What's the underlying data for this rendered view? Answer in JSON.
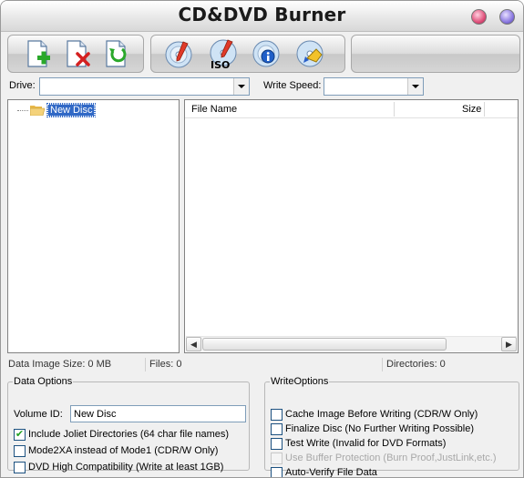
{
  "window": {
    "title": "CD&DVD Burner"
  },
  "toolbar": {
    "file_buttons": [
      {
        "icon": "add-file-icon"
      },
      {
        "icon": "remove-file-icon"
      },
      {
        "icon": "refresh-file-icon"
      }
    ],
    "disc_buttons": [
      {
        "icon": "burn-disc-icon"
      },
      {
        "icon": "burn-iso-icon",
        "label": "ISO"
      },
      {
        "icon": "disc-info-icon"
      },
      {
        "icon": "erase-disc-icon"
      }
    ]
  },
  "drive": {
    "label": "Drive:",
    "value": ""
  },
  "write_speed": {
    "label": "Write Speed:",
    "value": ""
  },
  "tree": {
    "root_label": "New Disc"
  },
  "file_list": {
    "columns": [
      "File Name",
      "Size"
    ],
    "rows": []
  },
  "status": {
    "image_size": "Data Image Size: 0 MB",
    "files": "Files: 0",
    "directories": "Directories: 0"
  },
  "data_options": {
    "legend": "Data Options",
    "volume_id_label": "Volume ID:",
    "volume_id_value": "New Disc",
    "checks": [
      {
        "label": "Include Joliet Directories (64 char file names)",
        "checked": true
      },
      {
        "label": "Mode2XA instead of Mode1 (CDR/W Only)",
        "checked": false
      },
      {
        "label": "DVD High Compatibility (Write at least 1GB)",
        "checked": false
      }
    ]
  },
  "write_options": {
    "legend": "WriteOptions",
    "checks": [
      {
        "label": "Cache Image Before Writing (CDR/W Only)",
        "checked": false,
        "enabled": true
      },
      {
        "label": "Finalize Disc (No Further Writing Possible)",
        "checked": false,
        "enabled": true
      },
      {
        "label": "Test Write (Invalid for DVD Formats)",
        "checked": false,
        "enabled": true
      },
      {
        "label": "Use Buffer Protection (Burn Proof,JustLink,etc.)",
        "checked": false,
        "enabled": false
      },
      {
        "label": "Auto-Verify File Data",
        "checked": false,
        "enabled": true
      }
    ]
  },
  "colors": {
    "selection": "#3169c6",
    "check": "#21a121"
  }
}
